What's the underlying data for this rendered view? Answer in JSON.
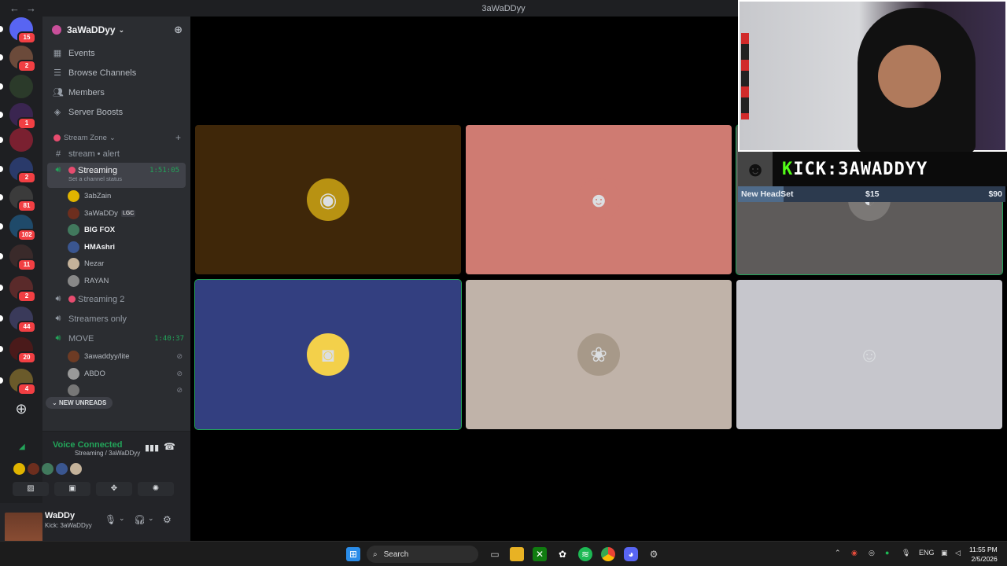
{
  "window": {
    "title": "3aWaDDyy",
    "back_icon": "←",
    "forward_icon": "→"
  },
  "servers": [
    {
      "badge": "15"
    },
    {
      "badge": "2"
    },
    {
      "badge": ""
    },
    {
      "badge": "1"
    },
    {
      "badge": ""
    },
    {
      "badge": "2"
    },
    {
      "badge": "81"
    },
    {
      "badge": "102"
    },
    {
      "badge": "11"
    },
    {
      "badge": "2"
    },
    {
      "badge": "44"
    },
    {
      "badge": "20"
    },
    {
      "badge": "4"
    }
  ],
  "guild": {
    "name": "3aWaDDyy"
  },
  "menu": [
    {
      "label": "Events",
      "icon": "calendar-icon"
    },
    {
      "label": "Browse Channels",
      "icon": "list-icon"
    },
    {
      "label": "Members",
      "icon": "members-icon"
    },
    {
      "label": "Server Boosts",
      "icon": "boost-icon"
    }
  ],
  "category": {
    "label": "Stream Zone"
  },
  "channels": {
    "text1": "stream • alert",
    "streaming": {
      "label": "Streaming",
      "time": "1:51:05",
      "status": "Set a channel status"
    },
    "streaming_users": [
      {
        "name": "3abZain",
        "bold": false,
        "color": "#e0b400"
      },
      {
        "name": "3aWaDDy",
        "bold": false,
        "tag": "LGC",
        "color": "#6d2e1e"
      },
      {
        "name": "BIG FOX",
        "bold": true,
        "color": "#41795d"
      },
      {
        "name": "HMAshri",
        "bold": true,
        "color": "#3a5690"
      },
      {
        "name": "Nezar",
        "bold": false,
        "color": "#c4b29a"
      },
      {
        "name": "RAYAN",
        "bold": false,
        "color": "#888"
      }
    ],
    "streaming2": "Streaming 2",
    "streamers_only": "Streamers only",
    "move": {
      "label": "MOVE",
      "time": "1:40:37"
    },
    "move_users": [
      {
        "name": "3awaddyy/lite",
        "color": "#6d3b24"
      },
      {
        "name": "ABDO",
        "color": "#999"
      },
      {
        "name": "",
        "color": "#777"
      }
    ]
  },
  "new_unreads": "NEW UNREADS",
  "voice": {
    "status": "Voice Connected",
    "sub": "Streaming / 3aWaDDyy"
  },
  "user_panel": {
    "name": "WaDDy",
    "status": "Kick: 3aWaDDyy",
    "overlay": "x50",
    "weather": "cloudy"
  },
  "tiles": [
    {
      "bg": "#3f2709",
      "avatar_bg": "#b89212",
      "glyph": "◉",
      "speaking": false
    },
    {
      "bg": "#cf7b72",
      "avatar_bg": "#cf7b72",
      "glyph": "☻",
      "speaking": false
    },
    {
      "bg": "#5e5b5a",
      "avatar_bg": "#7b7876",
      "glyph": "◐",
      "speaking": true
    },
    {
      "bg": "#333f80",
      "avatar_bg": "#f3d04a",
      "glyph": "◙",
      "speaking": true
    },
    {
      "bg": "#c0b3a9",
      "avatar_bg": "#a79989",
      "glyph": "❀",
      "speaking": false
    },
    {
      "bg": "#c6c6cc",
      "avatar_bg": "#c6c6cc",
      "glyph": "☺",
      "speaking": false
    }
  ],
  "overlay": {
    "kick_prefix": "K",
    "kick_label": "ICK:3AWADDYY",
    "goal_label": "New HeadSet",
    "goal_current": "$15",
    "goal_target": "$90",
    "goal_fraction": 0.17
  },
  "taskbar": {
    "search_placeholder": "Search",
    "lang": "ENG",
    "time": "11:55 PM",
    "date": "2/5/2026"
  }
}
